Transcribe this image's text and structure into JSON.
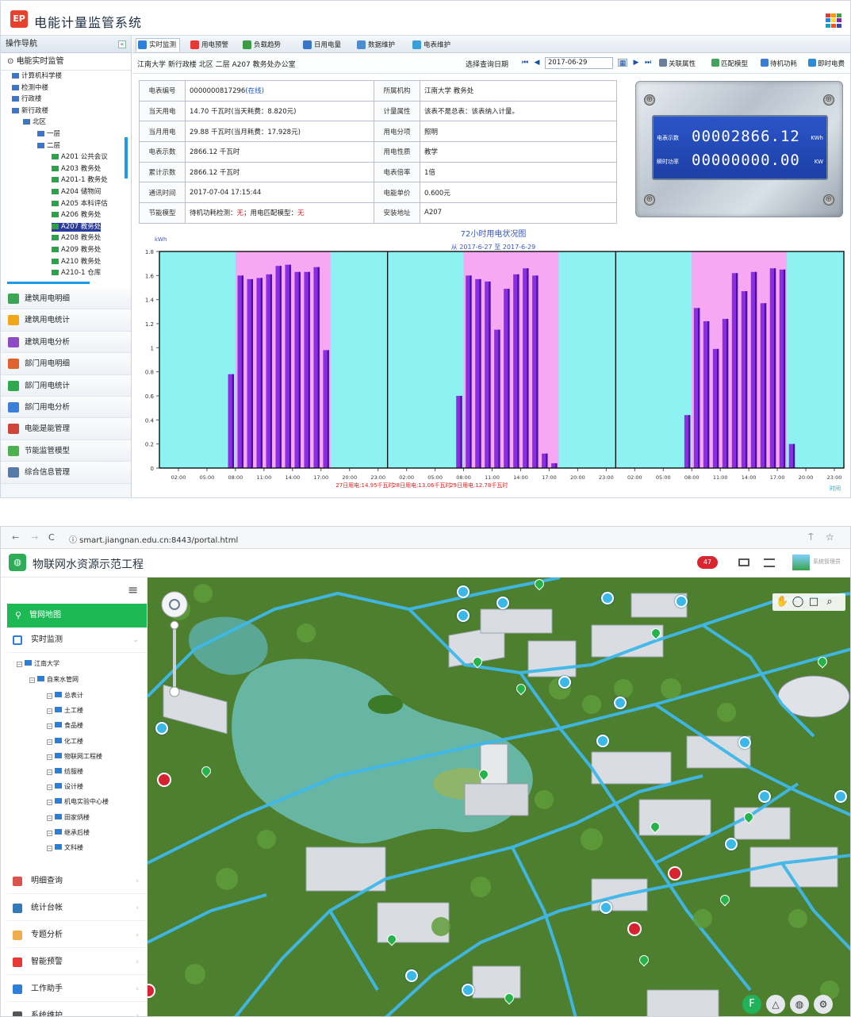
{
  "p1": {
    "logo_text": "EP",
    "title": "电能计量监管系统",
    "grid_colors": [
      "#e53935",
      "#ff9800",
      "#43a047",
      "#1e88e5",
      "#fdd835",
      "#8e24aa",
      "#00acc1",
      "#f4511e",
      "#3949ab"
    ],
    "sidebar": {
      "header": "操作导航",
      "toggle": "«",
      "sub": "电能实时监管",
      "tree": [
        {
          "label": "计算机科学楼",
          "indent": 14
        },
        {
          "label": "检测中楼",
          "indent": 14
        },
        {
          "label": "行政楼",
          "indent": 14
        },
        {
          "label": "新行政楼",
          "indent": 14
        },
        {
          "label": "北区",
          "indent": 28
        },
        {
          "label": "一层",
          "indent": 46
        },
        {
          "label": "二层",
          "indent": 46
        },
        {
          "label": "A201 公共会议",
          "indent": 64
        },
        {
          "label": "A203 教务处",
          "indent": 64
        },
        {
          "label": "A201-1 教务处",
          "indent": 64
        },
        {
          "label": "A204 储物间",
          "indent": 64
        },
        {
          "label": "A205 本科评估",
          "indent": 64
        },
        {
          "label": "A206 教务处",
          "indent": 64
        },
        {
          "label": "A207 教务处",
          "indent": 64,
          "selected": true
        },
        {
          "label": "A208 教务处",
          "indent": 64
        },
        {
          "label": "A209 教务处",
          "indent": 64
        },
        {
          "label": "A210 教务处",
          "indent": 64
        },
        {
          "label": "A210-1 仓库",
          "indent": 64
        }
      ],
      "menu": [
        {
          "label": "建筑用电明细",
          "color": "#3aa655"
        },
        {
          "label": "建筑用电统计",
          "color": "#f0a81a"
        },
        {
          "label": "建筑用电分析",
          "color": "#8e4bc6"
        },
        {
          "label": "部门用电明细",
          "color": "#e0622c"
        },
        {
          "label": "部门用电统计",
          "color": "#2fa84f"
        },
        {
          "label": "部门用电分析",
          "color": "#3c7fd6"
        },
        {
          "label": "电能是能管理",
          "color": "#d0453b"
        },
        {
          "label": "节能监管模型",
          "color": "#4caf50"
        },
        {
          "label": "综合信息管理",
          "color": "#5979a8"
        }
      ]
    },
    "tabs": [
      {
        "label": "实时监测",
        "color": "#2f7ed8",
        "active": true
      },
      {
        "label": "用电预警",
        "color": "#e53935"
      },
      {
        "label": "负载趋势",
        "color": "#3b9c45"
      },
      {
        "label": "日用电量",
        "color": "#3a76c7"
      },
      {
        "label": "数据维护",
        "color": "#4e8bd1"
      },
      {
        "label": "电表维护",
        "color": "#3aa0d6"
      }
    ],
    "crumb": "江南大学 新行政楼 北区 二层 A207 教务处办公室",
    "date_label": "选择查询日期",
    "date_value": "2017-06-29",
    "nav_first": "⏮",
    "nav_prev": "◀",
    "nav_next": "▶",
    "nav_last": "⏭",
    "cal_icon": "▦",
    "toolbar": [
      {
        "label": "关联属性",
        "color": "#6a7f99"
      },
      {
        "label": "匹配模型",
        "color": "#44a35a"
      },
      {
        "label": "待机功耗",
        "color": "#3b7bd2"
      },
      {
        "label": "即时电费",
        "color": "#2d8bd6"
      }
    ],
    "info": [
      {
        "k1": "电表编号",
        "v1": "0000000817296",
        "v1_tag": "(在线)",
        "k2": "所属机构",
        "v2": "江南大学 教务处"
      },
      {
        "k1": "当天用电",
        "v1": "14.70 千瓦时(当天耗费：8.820元)",
        "k2": "计量属性",
        "v2": "该表不是总表：该表纳入计量。"
      },
      {
        "k1": "当月用电",
        "v1": "29.88 千瓦时(当月耗费：17.928元)",
        "k2": "用电分项",
        "v2": "照明"
      },
      {
        "k1": "电表示数",
        "v1": "2866.12 千瓦时",
        "k2": "用电性质",
        "v2": "教学"
      },
      {
        "k1": "累计示数",
        "v1": "2866.12 千瓦时",
        "k2": "电表倍率",
        "v2": "1倍"
      },
      {
        "k1": "通讯时间",
        "v1": "2017-07-04 17:15:44",
        "k2": "电能单价",
        "v2": "0.600元"
      },
      {
        "k1": "节能模型",
        "v1_a": "待机功耗检测：",
        "v1_b": "无",
        "v1_c": "；用电匹配模型：",
        "v1_d": "无",
        "k2": "安装地址",
        "v2": "A207"
      }
    ],
    "meter": {
      "screw": "⊕",
      "row1_label": "电表示数",
      "row1_value": "00002866.12",
      "row1_unit": "KWh",
      "row2_label": "瞬时功率",
      "row2_value": "00000000.00",
      "row2_unit": "KW"
    }
  },
  "chart_data": {
    "type": "bar",
    "title": "72小时用电状况图",
    "subtitle": "从 2017-6-27 至 2017-6-29",
    "ylabel": "kWh",
    "xlabel": "时间",
    "ylim": [
      0,
      1.8
    ],
    "yticks": [
      0,
      0.2,
      0.4,
      0.6,
      0.8,
      1,
      1.2,
      1.4,
      1.6,
      1.8
    ],
    "xticks": [
      "02:00",
      "05:00",
      "08:00",
      "11:00",
      "14:00",
      "17:00",
      "20:00",
      "23:00"
    ],
    "workday_band_hours": [
      8,
      18
    ],
    "series": [
      {
        "day": "2017-06-27",
        "hourly": [
          0,
          0,
          0,
          0,
          0,
          0,
          0,
          0.78,
          1.6,
          1.57,
          1.58,
          1.61,
          1.68,
          1.69,
          1.63,
          1.63,
          1.67,
          0.98,
          0,
          0,
          0,
          0,
          0,
          0
        ]
      },
      {
        "day": "2017-06-28",
        "hourly": [
          0,
          0,
          0,
          0,
          0,
          0,
          0,
          0.6,
          1.6,
          1.57,
          1.55,
          1.15,
          1.49,
          1.61,
          1.66,
          1.6,
          0.12,
          0.04,
          0,
          0,
          0,
          0,
          0,
          0
        ]
      },
      {
        "day": "2017-06-29",
        "hourly": [
          0,
          0,
          0,
          0,
          0,
          0,
          0,
          0.44,
          1.33,
          1.22,
          0.99,
          1.24,
          1.62,
          1.47,
          1.63,
          1.37,
          1.66,
          1.65,
          0.2,
          0,
          0,
          0,
          0,
          0
        ]
      }
    ],
    "daily_totals": [
      {
        "text": "27日用电:14.95千瓦时"
      },
      {
        "text": "28日用电:13.06千瓦时"
      },
      {
        "text": "29日用电:12.78千瓦时"
      }
    ],
    "colors": {
      "band": "#f6a8f2",
      "bg": "#8ef2f2",
      "bar": "#8b2ee3",
      "bar_dark": "#4b0ca7"
    }
  },
  "p2": {
    "back": "←",
    "forward": "→",
    "reload": "C",
    "url": "ⓘ smart.jiangnan.edu.cn:8443/portal.html",
    "star": "☆",
    "pin_icon": "⍑",
    "logo_text": "◍",
    "title": "物联网水资源示范工程",
    "badge": "47",
    "user_label": "系统管理员",
    "menu_icon": "≡",
    "nav_active": "管网地图",
    "realtime": "实时监测",
    "tree_root": "江南大学",
    "tree_sub": "自来水管网",
    "tree_items": [
      "总表计",
      "土工楼",
      "食品楼",
      "化工楼",
      "物联网工程楼",
      "纺服楼",
      "设计楼",
      "机电实验中心楼",
      "田家炳楼",
      "继承后楼",
      "文科楼"
    ],
    "menu": [
      {
        "label": "明细查询",
        "color": "#d9534f"
      },
      {
        "label": "统计台帐",
        "color": "#337ab7"
      },
      {
        "label": "专题分析",
        "color": "#f0ad4e"
      },
      {
        "label": "智能预警",
        "color": "#e53935"
      },
      {
        "label": "工作助手",
        "color": "#2f7ed8"
      },
      {
        "label": "系统维护",
        "color": "#555555"
      }
    ],
    "map_tools": [
      "✋",
      "◯",
      "□",
      "⌕"
    ],
    "zoom_glyph": "◆"
  }
}
